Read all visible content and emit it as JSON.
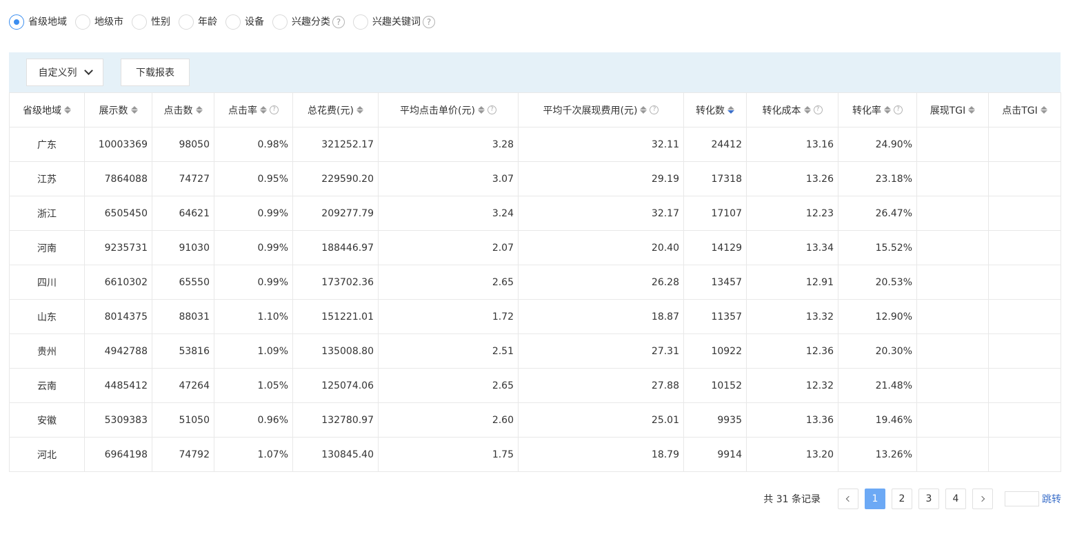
{
  "filters": [
    {
      "label": "省级地域",
      "checked": true,
      "help": false
    },
    {
      "label": "地级市",
      "checked": false,
      "help": false
    },
    {
      "label": "性别",
      "checked": false,
      "help": false
    },
    {
      "label": "年龄",
      "checked": false,
      "help": false
    },
    {
      "label": "设备",
      "checked": false,
      "help": false
    },
    {
      "label": "兴趣分类",
      "checked": false,
      "help": true
    },
    {
      "label": "兴趣关键词",
      "checked": false,
      "help": true
    }
  ],
  "help_glyph": "?",
  "toolbar": {
    "custom_columns_label": "自定义列",
    "download_label": "下载报表"
  },
  "columns": [
    {
      "label": "省级地域",
      "sortable": true,
      "help": false,
      "active_sort": ""
    },
    {
      "label": "展示数",
      "sortable": true,
      "help": false,
      "active_sort": ""
    },
    {
      "label": "点击数",
      "sortable": true,
      "help": false,
      "active_sort": ""
    },
    {
      "label": "点击率",
      "sortable": true,
      "help": true,
      "active_sort": ""
    },
    {
      "label": "总花费(元)",
      "sortable": true,
      "help": false,
      "active_sort": ""
    },
    {
      "label": "平均点击单价(元)",
      "sortable": true,
      "help": true,
      "active_sort": ""
    },
    {
      "label": "平均千次展现费用(元)",
      "sortable": true,
      "help": true,
      "active_sort": ""
    },
    {
      "label": "转化数",
      "sortable": true,
      "help": false,
      "active_sort": "desc"
    },
    {
      "label": "转化成本",
      "sortable": true,
      "help": true,
      "active_sort": ""
    },
    {
      "label": "转化率",
      "sortable": true,
      "help": true,
      "active_sort": ""
    },
    {
      "label": "展现TGI",
      "sortable": true,
      "help": false,
      "active_sort": ""
    },
    {
      "label": "点击TGI",
      "sortable": true,
      "help": false,
      "active_sort": ""
    }
  ],
  "rows": [
    [
      "广东",
      "10003369",
      "98050",
      "0.98%",
      "321252.17",
      "3.28",
      "32.11",
      "24412",
      "13.16",
      "24.90%",
      "",
      ""
    ],
    [
      "江苏",
      "7864088",
      "74727",
      "0.95%",
      "229590.20",
      "3.07",
      "29.19",
      "17318",
      "13.26",
      "23.18%",
      "",
      ""
    ],
    [
      "浙江",
      "6505450",
      "64621",
      "0.99%",
      "209277.79",
      "3.24",
      "32.17",
      "17107",
      "12.23",
      "26.47%",
      "",
      ""
    ],
    [
      "河南",
      "9235731",
      "91030",
      "0.99%",
      "188446.97",
      "2.07",
      "20.40",
      "14129",
      "13.34",
      "15.52%",
      "",
      ""
    ],
    [
      "四川",
      "6610302",
      "65550",
      "0.99%",
      "173702.36",
      "2.65",
      "26.28",
      "13457",
      "12.91",
      "20.53%",
      "",
      ""
    ],
    [
      "山东",
      "8014375",
      "88031",
      "1.10%",
      "151221.01",
      "1.72",
      "18.87",
      "11357",
      "13.32",
      "12.90%",
      "",
      ""
    ],
    [
      "贵州",
      "4942788",
      "53816",
      "1.09%",
      "135008.80",
      "2.51",
      "27.31",
      "10922",
      "12.36",
      "20.30%",
      "",
      ""
    ],
    [
      "云南",
      "4485412",
      "47264",
      "1.05%",
      "125074.06",
      "2.65",
      "27.88",
      "10152",
      "12.32",
      "21.48%",
      "",
      ""
    ],
    [
      "安徽",
      "5309383",
      "51050",
      "0.96%",
      "132780.97",
      "2.60",
      "25.01",
      "9935",
      "13.36",
      "19.46%",
      "",
      ""
    ],
    [
      "河北",
      "6964198",
      "74792",
      "1.07%",
      "130845.40",
      "1.75",
      "18.79",
      "9914",
      "13.20",
      "13.26%",
      "",
      ""
    ]
  ],
  "pagination": {
    "total_text": "共 31 条记录",
    "pages": [
      "1",
      "2",
      "3",
      "4"
    ],
    "current_page": "1",
    "jump_label": "跳转"
  }
}
